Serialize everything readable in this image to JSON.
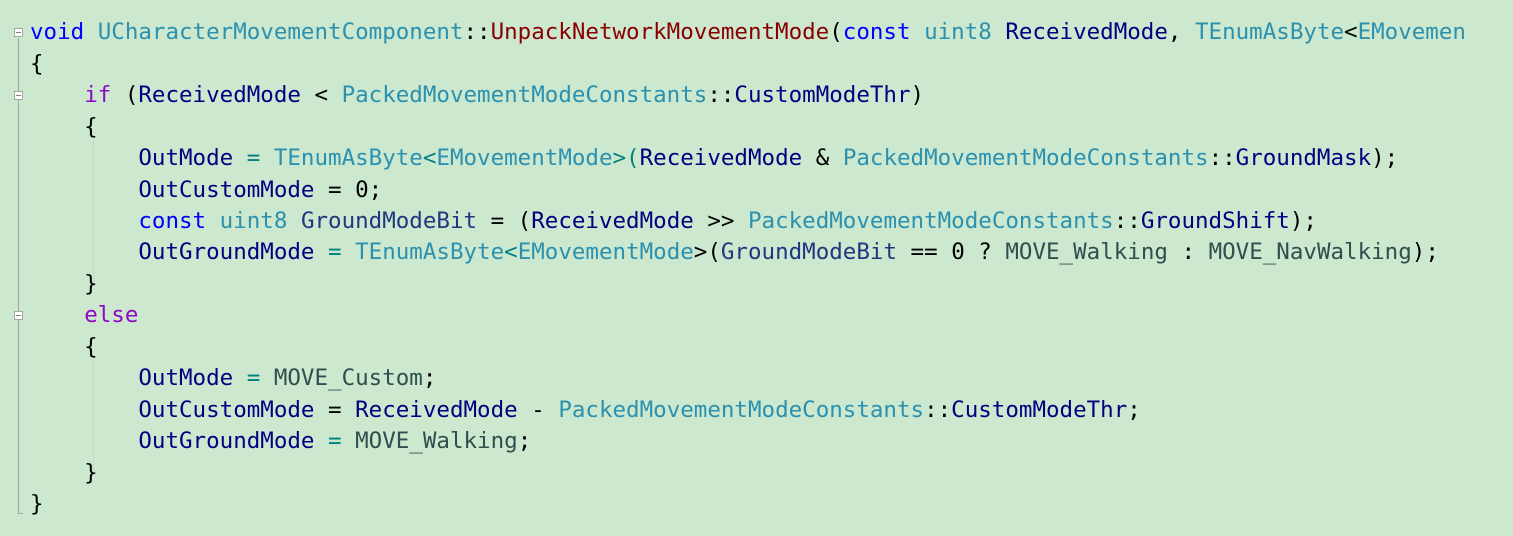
{
  "editor": {
    "background": "#cce8cf",
    "lines": [
      "void UCharacterMovementComponent::UnpackNetworkMovementMode(const uint8 ReceivedMode, TEnumAsByte<EMovemen",
      "{",
      "    if (ReceivedMode < PackedMovementModeConstants::CustomModeThr)",
      "    {",
      "        OutMode = TEnumAsByte<EMovementMode>(ReceivedMode & PackedMovementModeConstants::GroundMask);",
      "        OutCustomMode = 0;",
      "        const uint8 GroundModeBit = (ReceivedMode >> PackedMovementModeConstants::GroundShift);",
      "        OutGroundMode = TEnumAsByte<EMovementMode>(GroundModeBit == 0 ? MOVE_Walking : MOVE_NavWalking);",
      "    }",
      "    else",
      "    {",
      "        OutMode = MOVE_Custom;",
      "        OutCustomMode = ReceivedMode - PackedMovementModeConstants::CustomModeThr;",
      "        OutGroundMode = MOVE_Walking;",
      "    }",
      "}"
    ],
    "tokens": {
      "l0": [
        "void",
        " ",
        "UCharacterMovementComponent",
        "::",
        "UnpackNetworkMovementMode",
        "(",
        "const",
        " ",
        "uint8",
        " ",
        "ReceivedMode",
        ", ",
        "TEnumAsByte",
        "<",
        "EMovemen"
      ],
      "l1": [
        "{"
      ],
      "l2": [
        "    ",
        "if",
        " (",
        "ReceivedMode",
        " < ",
        "PackedMovementModeConstants",
        "::",
        "CustomModeThr",
        ")"
      ],
      "l3": [
        "    {"
      ],
      "l4": [
        "        ",
        "OutMode",
        " = ",
        "TEnumAsByte",
        "<",
        "EMovementMode",
        ">(",
        "ReceivedMode",
        " & ",
        "PackedMovementModeConstants",
        "::",
        "GroundMask",
        ");"
      ],
      "l5": [
        "        ",
        "OutCustomMode",
        " = ",
        "0",
        ";"
      ],
      "l6": [
        "        ",
        "const",
        " ",
        "uint8",
        " ",
        "GroundModeBit",
        " = (",
        "ReceivedMode",
        " >> ",
        "PackedMovementModeConstants",
        "::",
        "GroundShift",
        ");"
      ],
      "l7": [
        "        ",
        "OutGroundMode",
        " = ",
        "TEnumAsByte",
        "<",
        "EMovementMode",
        ">(",
        "GroundModeBit",
        " == ",
        "0",
        " ? ",
        "MOVE_Walking",
        " : ",
        "MOVE_NavWalking",
        ");"
      ],
      "l8": [
        "    }"
      ],
      "l9": [
        "    ",
        "else"
      ],
      "l10": [
        "    {"
      ],
      "l11": [
        "        ",
        "OutMode",
        " = ",
        "MOVE_Custom",
        ";"
      ],
      "l12": [
        "        ",
        "OutCustomMode",
        " = ",
        "ReceivedMode",
        " - ",
        "PackedMovementModeConstants",
        "::",
        "CustomModeThr",
        ";"
      ],
      "l13": [
        "        ",
        "OutGroundMode",
        " = ",
        "MOVE_Walking",
        ";"
      ],
      "l14": [
        "    }"
      ],
      "l15": [
        "}"
      ]
    }
  }
}
